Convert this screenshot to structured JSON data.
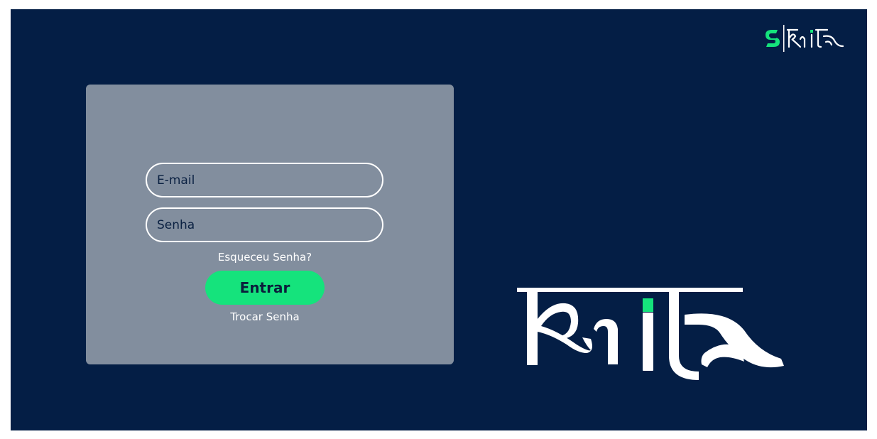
{
  "brand": {
    "name": "Krita",
    "colors": {
      "background": "#041e45",
      "card": "#828e9e",
      "accent": "#15e37c",
      "text": "#ffffff"
    },
    "icons": [
      "krita-small-logo",
      "krita-large-logo"
    ]
  },
  "login": {
    "email_placeholder": "E-mail",
    "password_placeholder": "Senha",
    "forgot_password": "Esqueceu Senha?",
    "submit_label": "Entrar",
    "change_password": "Trocar Senha"
  }
}
